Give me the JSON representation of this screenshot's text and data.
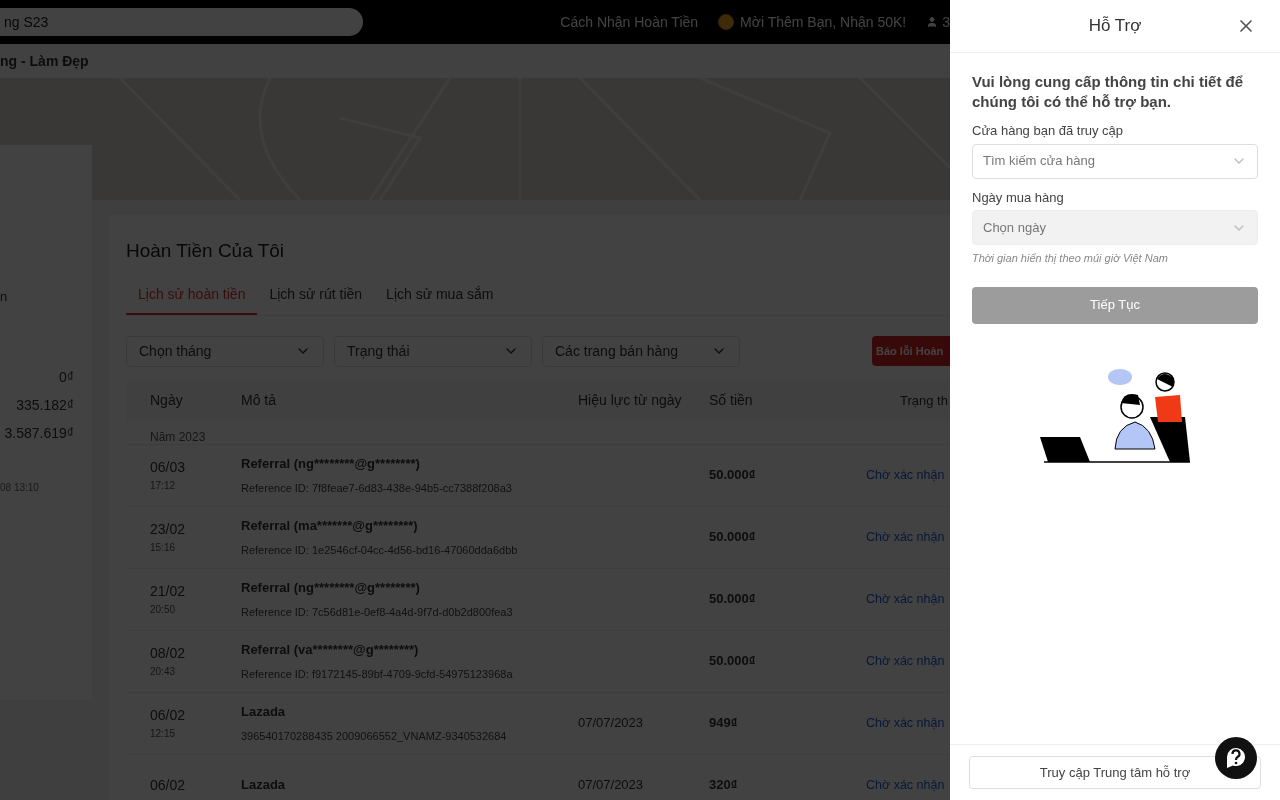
{
  "topbar": {
    "search": {
      "placeholder": "ng S23"
    },
    "links": [
      {
        "kind": "text",
        "label": "Cách Nhận Hoàn Tiền"
      },
      {
        "kind": "coin",
        "label": "Mời Thêm Bạn, Nhận 50K!"
      },
      {
        "kind": "user",
        "label": "3"
      }
    ]
  },
  "category_bar": {
    "label": "ng - Làm Đẹp"
  },
  "side_card": {
    "label": "n",
    "values": [
      "0₫",
      "335.182₫",
      "3.587.619₫"
    ],
    "footnote": "08 13:10"
  },
  "main": {
    "title": "Hoàn Tiền Của Tôi",
    "tabs": [
      {
        "label": "Lịch sử hoàn tiền",
        "selected": true
      },
      {
        "label": "Lịch sử rút tiền",
        "selected": false
      },
      {
        "label": "Lịch sử mua sắm",
        "selected": false
      }
    ],
    "filters": [
      "Chọn tháng",
      "Trạng thái",
      "Các trang bán hàng"
    ],
    "report_button": "Báo lỗi Hoàn",
    "table": {
      "columns": [
        "Ngày",
        "Mô tả",
        "Hiệu lực từ ngày",
        "Số tiền",
        "Trạng th"
      ],
      "year_group": "Năm 2023",
      "rows": [
        {
          "date": "06/03",
          "time": "17:12",
          "title": "Referral (ng********@g********)",
          "detail": "Reference ID: 7f8feae7-6d83-438e-94b5-cc7388f208a3",
          "effective": "",
          "amount": "50.000₫",
          "status": "Chờ xác nhận"
        },
        {
          "date": "23/02",
          "time": "15:16",
          "title": "Referral (ma*******@g********)",
          "detail": "Reference ID: 1e2546cf-04cc-4d56-bd16-47060dda6dbb",
          "effective": "",
          "amount": "50.000₫",
          "status": "Chờ xác nhận"
        },
        {
          "date": "21/02",
          "time": "20:50",
          "title": "Referral (ng********@g********)",
          "detail": "Reference ID: 7c56d81e-0ef8-4a4d-9f7d-d0b2d800fea3",
          "effective": "",
          "amount": "50.000₫",
          "status": "Chờ xác nhận"
        },
        {
          "date": "08/02",
          "time": "20:43",
          "title": "Referral (va********@g********)",
          "detail": "Reference ID: f9172145-89bf-4709-9cfd-54975123968a",
          "effective": "",
          "amount": "50.000₫",
          "status": "Chờ xác nhận"
        },
        {
          "date": "06/02",
          "time": "12:15",
          "title": "Lazada",
          "detail": "396540170288435 2009066552_VNAMZ-9340532684",
          "effective": "07/07/2023",
          "amount": "949₫",
          "status": "Chờ xác nhận"
        },
        {
          "date": "06/02",
          "title": "Lazada",
          "effective": "07/07/2023",
          "amount": "320₫",
          "status": "Chờ xác nhận"
        }
      ]
    }
  },
  "drawer": {
    "title": "Hỗ Trợ",
    "intro": "Vui lòng cung cấp thông tin chi tiết để chúng tôi có thể hỗ trợ bạn.",
    "fields": [
      {
        "label": "Cửa hàng bạn đã truy cập",
        "placeholder": "Tìm kiếm cửa hàng",
        "disabled": false
      },
      {
        "label": "Ngày mua hàng",
        "placeholder": "Chọn ngày",
        "disabled": true,
        "hint": "Thời gian hiển thị theo múi giờ Việt Nam"
      }
    ],
    "continue_button": {
      "label": "Tiếp Tục",
      "disabled": true
    },
    "footer_button": "Truy cập Trung tâm hỗ trợ"
  }
}
